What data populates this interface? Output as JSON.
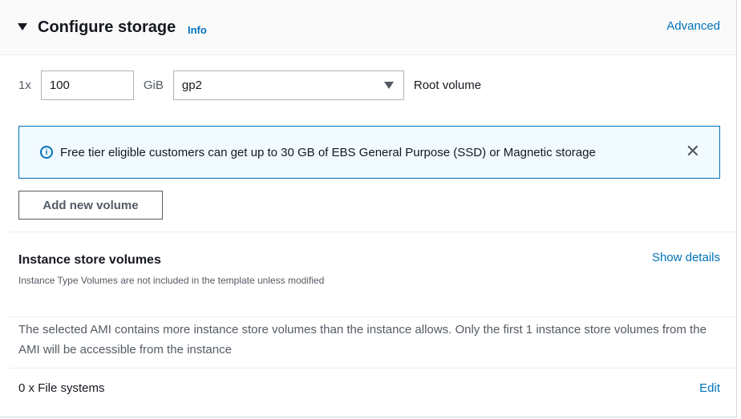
{
  "header": {
    "title": "Configure storage",
    "info": "Info",
    "advanced": "Advanced"
  },
  "volume": {
    "count": "1x",
    "size": "100",
    "unit": "GiB",
    "type": "gp2",
    "label": "Root volume"
  },
  "alert": {
    "text": "Free tier eligible customers can get up to 30 GB of EBS General Purpose (SSD) or Magnetic storage"
  },
  "add_volume": "Add new volume",
  "instance_store": {
    "title": "Instance store volumes",
    "subtitle": "Instance Type Volumes are not included in the template unless modified",
    "show_details": "Show details",
    "message": "The selected AMI contains more instance store volumes than the instance allows. Only the first 1 instance store volumes from the AMI will be accessible from the instance"
  },
  "file_systems": {
    "label": "0 x File systems",
    "edit": "Edit"
  },
  "colors": {
    "link": "#0073bb",
    "alert_bg": "#f1faff"
  }
}
